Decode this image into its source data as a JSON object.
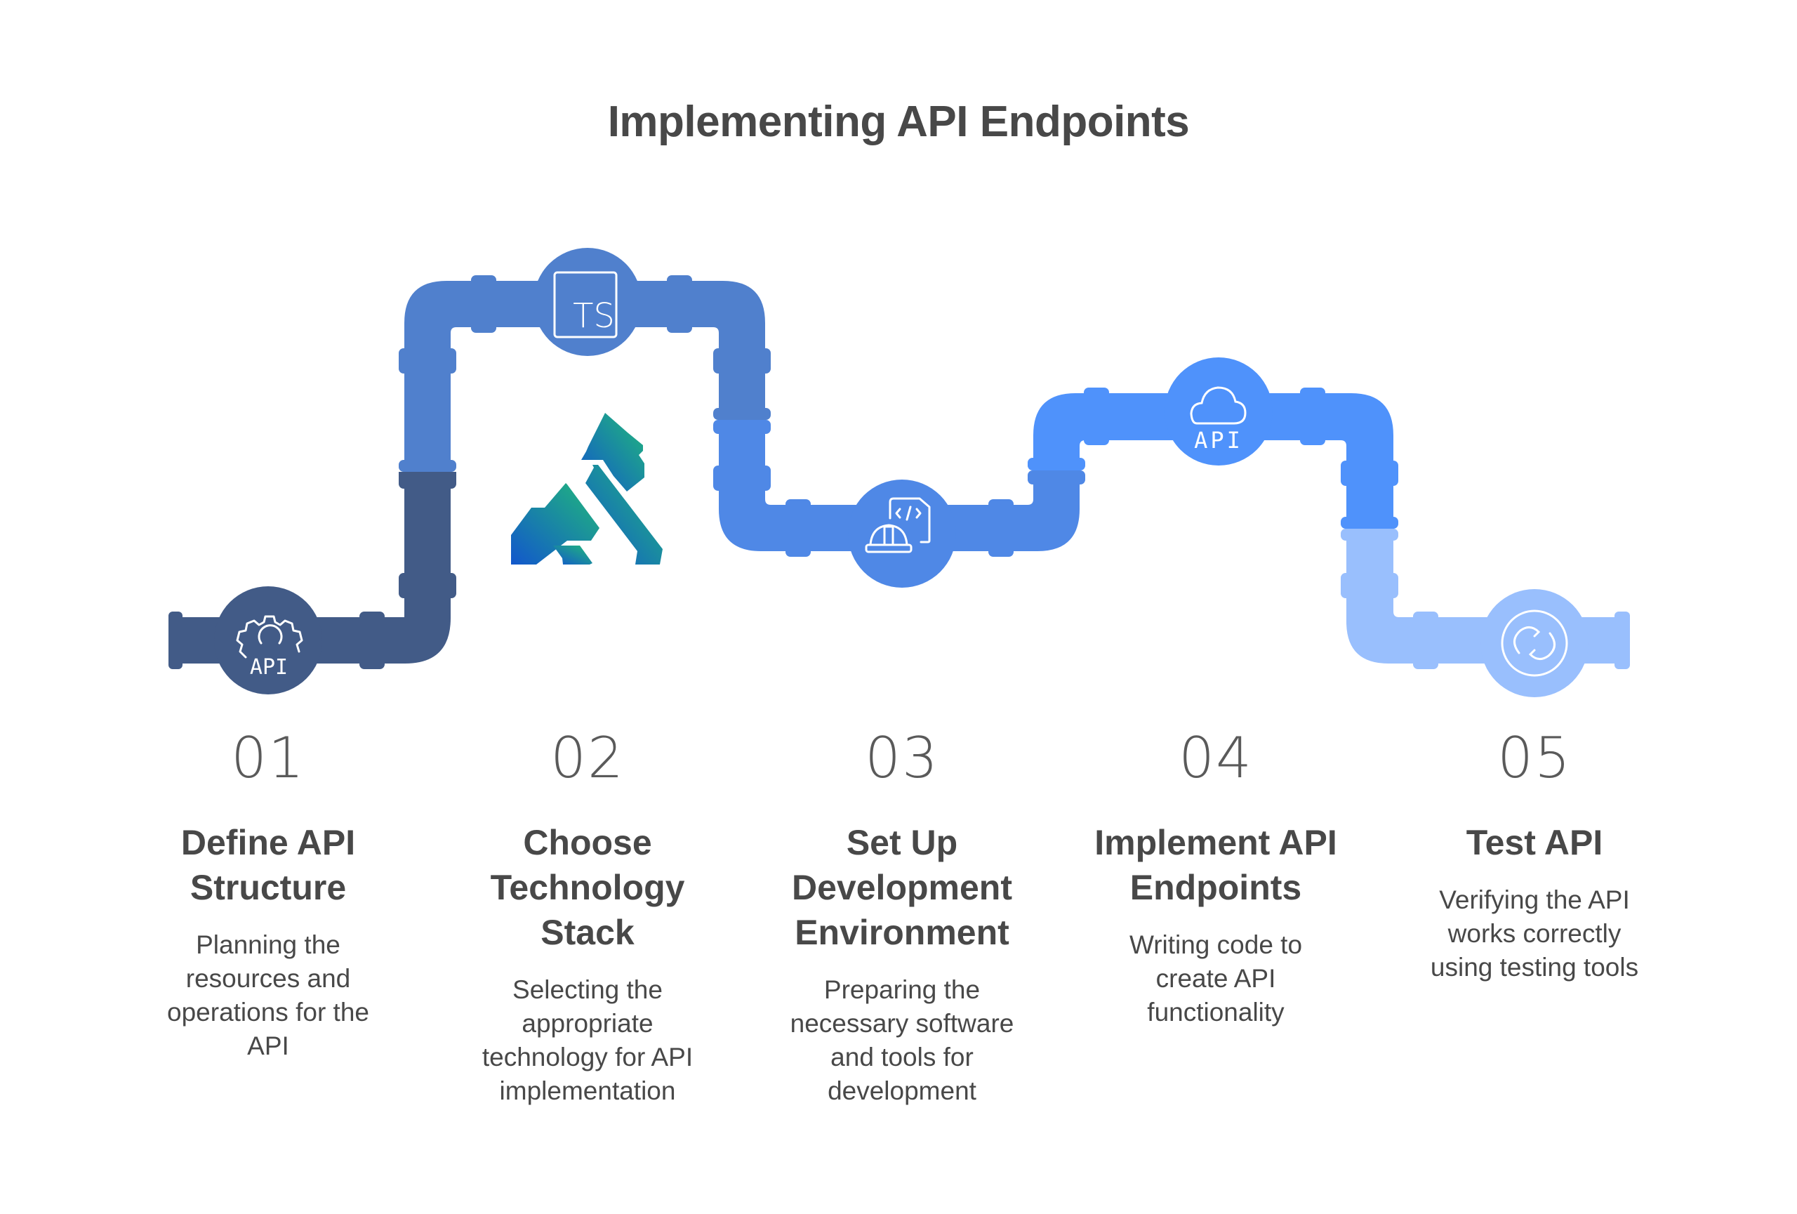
{
  "title": "Implementing API Endpoints",
  "colors": {
    "text": "#484848",
    "segment_1": "#425B87",
    "segment_2": "#5080CD",
    "segment_3": "#4F88E6",
    "segment_4": "#4F92FB",
    "segment_5": "#99BFFD",
    "logo_gradient_start": "#1257CC",
    "logo_gradient_end": "#21B97A",
    "icon_stroke": "#FFFFFF"
  },
  "logo": {
    "icon": "gorilla-logo-icon"
  },
  "steps": [
    {
      "number": "01",
      "title": "Define API Structure",
      "title_lines": [
        "Define API",
        "Structure"
      ],
      "description_lines": [
        "Planning the",
        "resources and",
        "operations for the",
        "API"
      ],
      "icon": "gear-api-icon",
      "icon_label": "API"
    },
    {
      "number": "02",
      "title": "Choose Technology Stack",
      "title_lines": [
        "Choose",
        "Technology",
        "Stack"
      ],
      "description_lines": [
        "Selecting the",
        "appropriate",
        "technology for API",
        "implementation"
      ],
      "icon": "typescript-icon",
      "icon_label": "TS"
    },
    {
      "number": "03",
      "title": "Set Up Development Environment",
      "title_lines": [
        "Set Up",
        "Development",
        "Environment"
      ],
      "description_lines": [
        "Preparing the",
        "necessary software",
        "and tools for",
        "development"
      ],
      "icon": "code-file-hardhat-icon",
      "icon_label": "</>"
    },
    {
      "number": "04",
      "title": "Implement API Endpoints",
      "title_lines": [
        "Implement API",
        "Endpoints"
      ],
      "description_lines": [
        "Writing code to",
        "create API",
        "functionality"
      ],
      "icon": "cloud-api-icon",
      "icon_label": "API"
    },
    {
      "number": "05",
      "title": "Test API",
      "title_lines": [
        "Test API"
      ],
      "description_lines": [
        "Verifying the API",
        "works correctly",
        "using testing tools"
      ],
      "icon": "link-circle-icon",
      "icon_label": ""
    }
  ]
}
